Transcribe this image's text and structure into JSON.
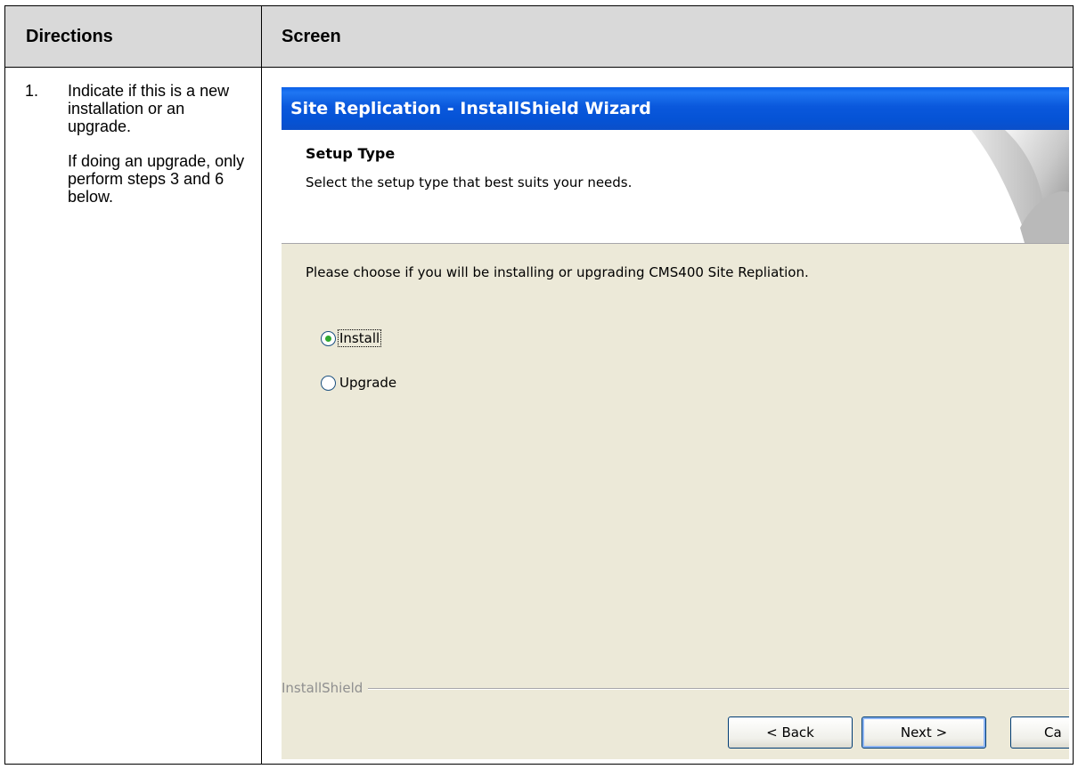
{
  "table": {
    "headers": [
      "Directions",
      "Screen"
    ]
  },
  "step": {
    "number": "1.",
    "instruction": "Indicate if this is a new installation or an upgrade.",
    "note": "If doing an upgrade, only perform steps 3 and 6 below."
  },
  "wizard": {
    "title": "Site Replication - InstallShield Wizard",
    "header_title": "Setup Type",
    "header_subtitle": "Select the setup type that best suits your needs.",
    "prompt": "Please choose if you will be installing or upgrading CMS400 Site Repliation.",
    "options": [
      {
        "label": "Install",
        "selected": true
      },
      {
        "label": "Upgrade",
        "selected": false
      }
    ],
    "brand": "InstallShield",
    "buttons": {
      "back": "< Back",
      "next": "Next >",
      "cancel": "Ca"
    }
  }
}
